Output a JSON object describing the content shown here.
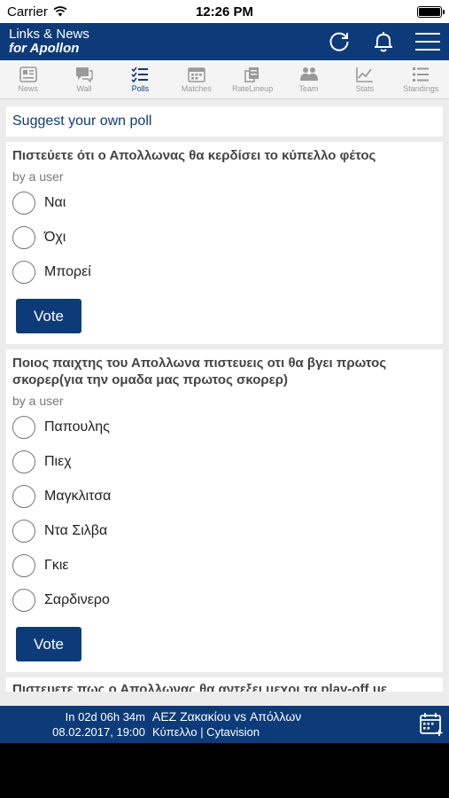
{
  "status": {
    "carrier": "Carrier",
    "time": "12:26 PM"
  },
  "app": {
    "title_line1": "Links & News",
    "title_line2": "for Apollon"
  },
  "tabs": [
    {
      "label": "News",
      "icon": "news-icon",
      "active": false
    },
    {
      "label": "Wall",
      "icon": "wall-icon",
      "active": false
    },
    {
      "label": "Polls",
      "icon": "polls-icon",
      "active": true
    },
    {
      "label": "Matches",
      "icon": "calendar-icon",
      "active": false
    },
    {
      "label": "RateLineup",
      "icon": "rate-lineup-icon",
      "active": false
    },
    {
      "label": "Team",
      "icon": "team-icon",
      "active": false
    },
    {
      "label": "Stats",
      "icon": "stats-icon",
      "active": false
    },
    {
      "label": "Standings",
      "icon": "standings-icon",
      "active": false
    }
  ],
  "suggest_label": "Suggest your own poll",
  "polls": [
    {
      "question": "Πιστεύετε ότι ο Απολλωνας θα κερδίσει το κύπελλο φέτος",
      "author": "by a user",
      "options": [
        "Ναι",
        "Όχι",
        "Μπορεί"
      ],
      "vote_label": "Vote"
    },
    {
      "question": "Ποιος παιχτης του Απολλωνα πιστευεις οτι θα βγει πρωτος σκορερ(για την ομαδα μας πρωτος σκορερ)",
      "author": "by a user",
      "options": [
        "Παπουλης",
        "Πιεχ",
        "Μαγκλιτσα",
        "Ντα Σιλβα",
        "Γκιε",
        "Σαρδινερο"
      ],
      "vote_label": "Vote"
    }
  ],
  "partial_poll_question": "Πιστευετε πως ο Απολλωνας θα αντεξει μεχρι τα play-off με",
  "next_match": {
    "countdown": "In 02d 06h 34m",
    "datetime": "08.02.2017, 19:00",
    "teams": "ΑΕΖ Ζακακίου vs Απόλλων",
    "info": "Κύπελλο | Cytavision"
  },
  "colors": {
    "brand": "#0d3b7a",
    "background": "#ececec"
  }
}
